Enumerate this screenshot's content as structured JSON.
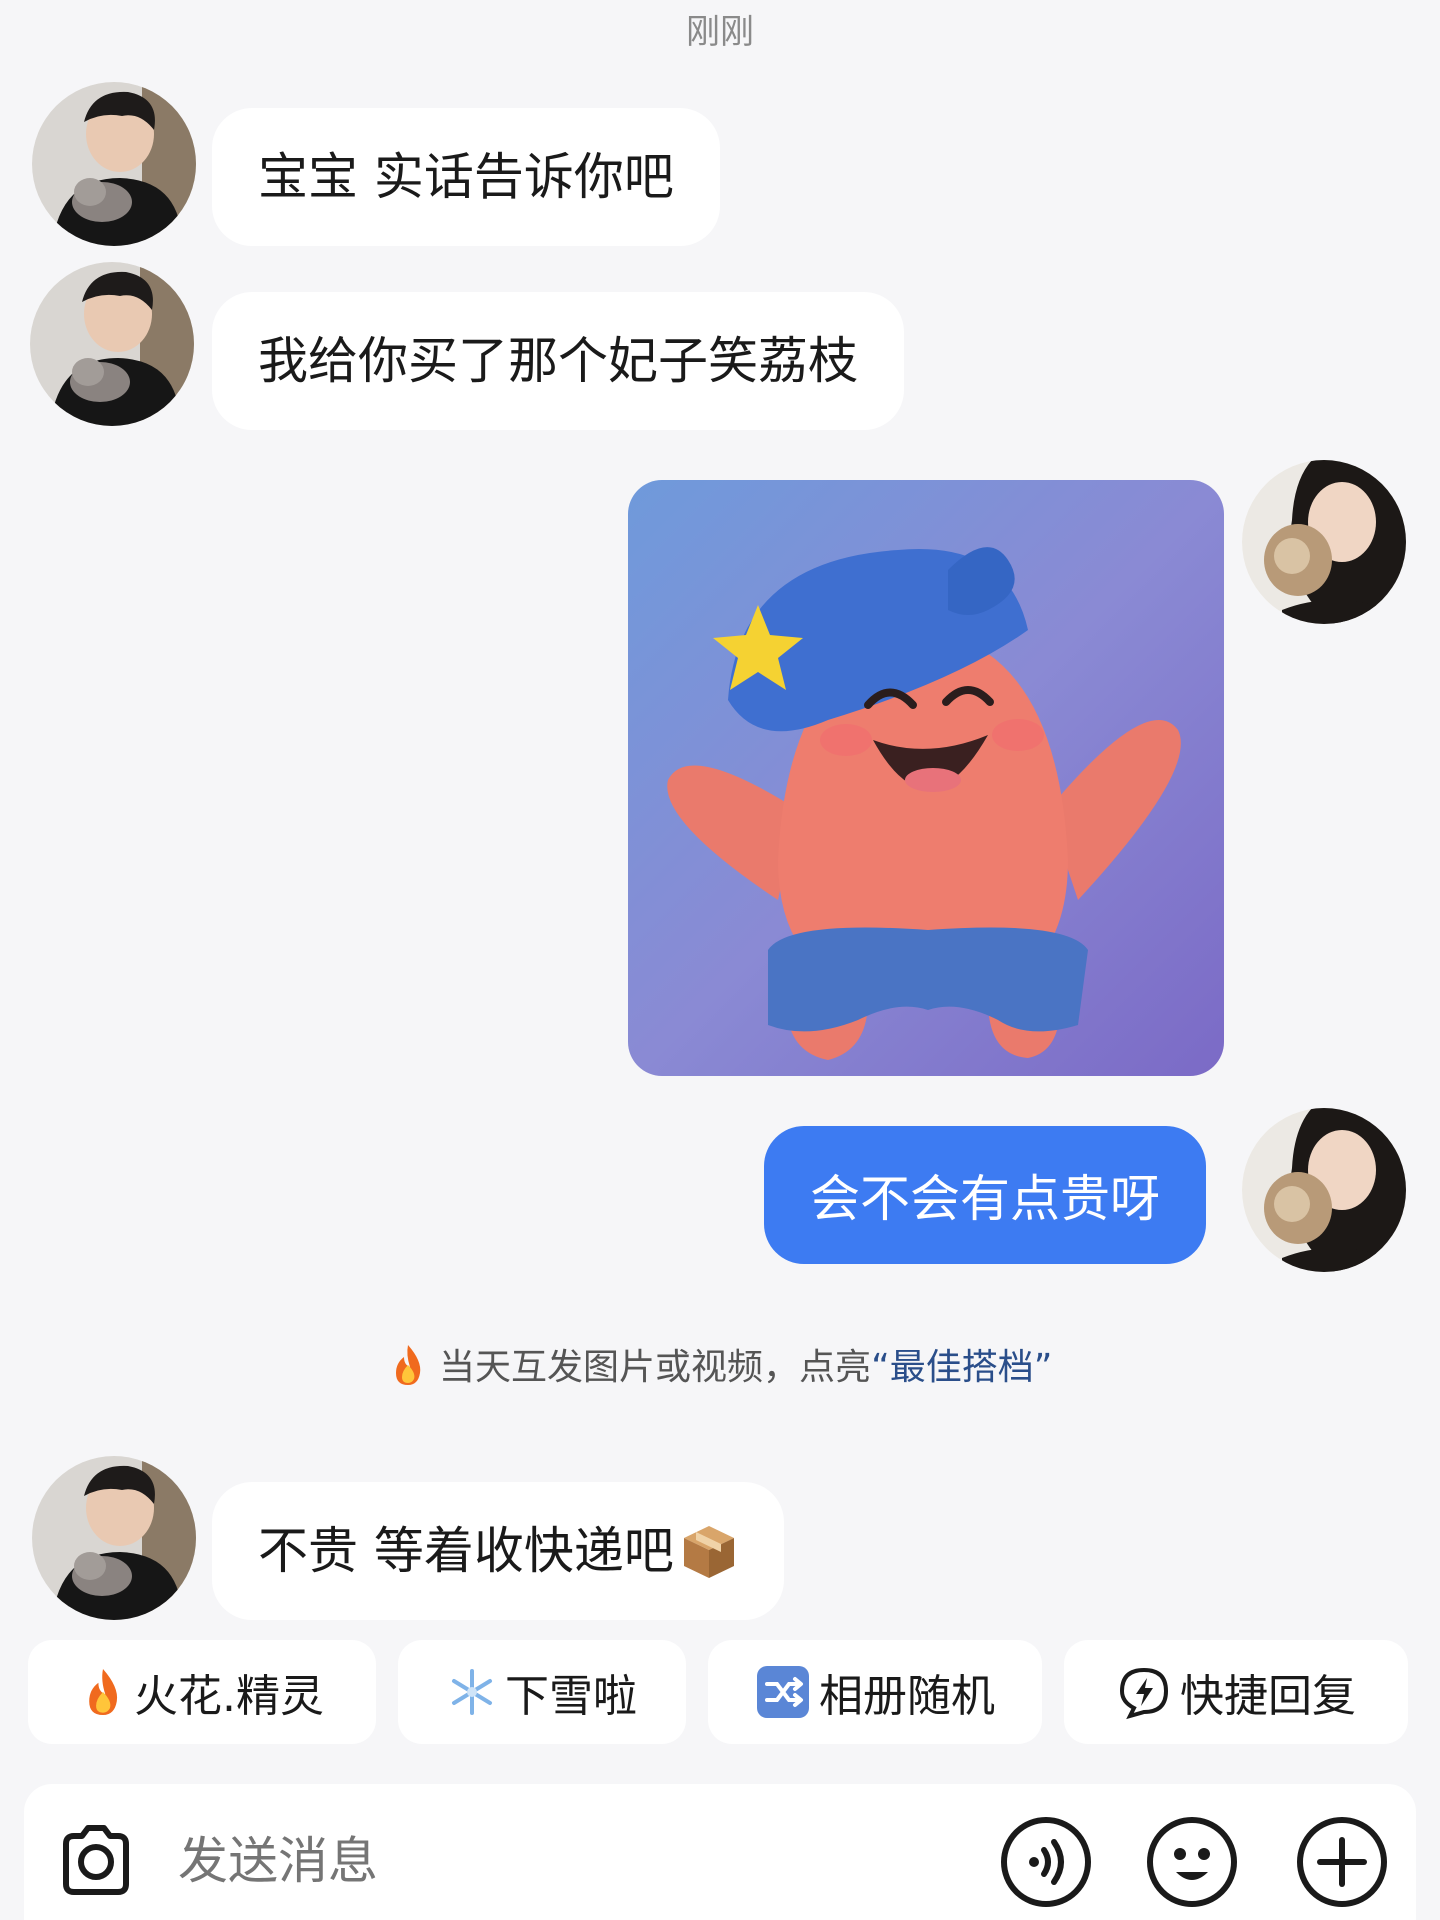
{
  "timestamp": "刚刚",
  "messages": {
    "m1": "宝宝 实话告诉你吧",
    "m2": "我给你买了那个妃子笑荔枝",
    "m4": "会不会有点贵呀",
    "m5": "不贵 等着收快递吧"
  },
  "notice": {
    "prefix": "当天互发图片或视频，点亮",
    "quote_open": "“",
    "highlight": "最佳搭档",
    "quote_close": "”"
  },
  "chips": {
    "c1": "火花.精灵",
    "c2": "下雪啦",
    "c3": "相册随机",
    "c4": "快捷回复"
  },
  "input": {
    "placeholder": "发送消息"
  },
  "colors": {
    "accent": "#3d7bf2",
    "background": "#f6f6f8"
  },
  "icons": [
    "fire-icon",
    "snowflake-icon",
    "shuffle-icon",
    "lightning-chat-icon",
    "camera-icon",
    "voice-icon",
    "emoji-icon",
    "plus-icon",
    "package-icon"
  ]
}
